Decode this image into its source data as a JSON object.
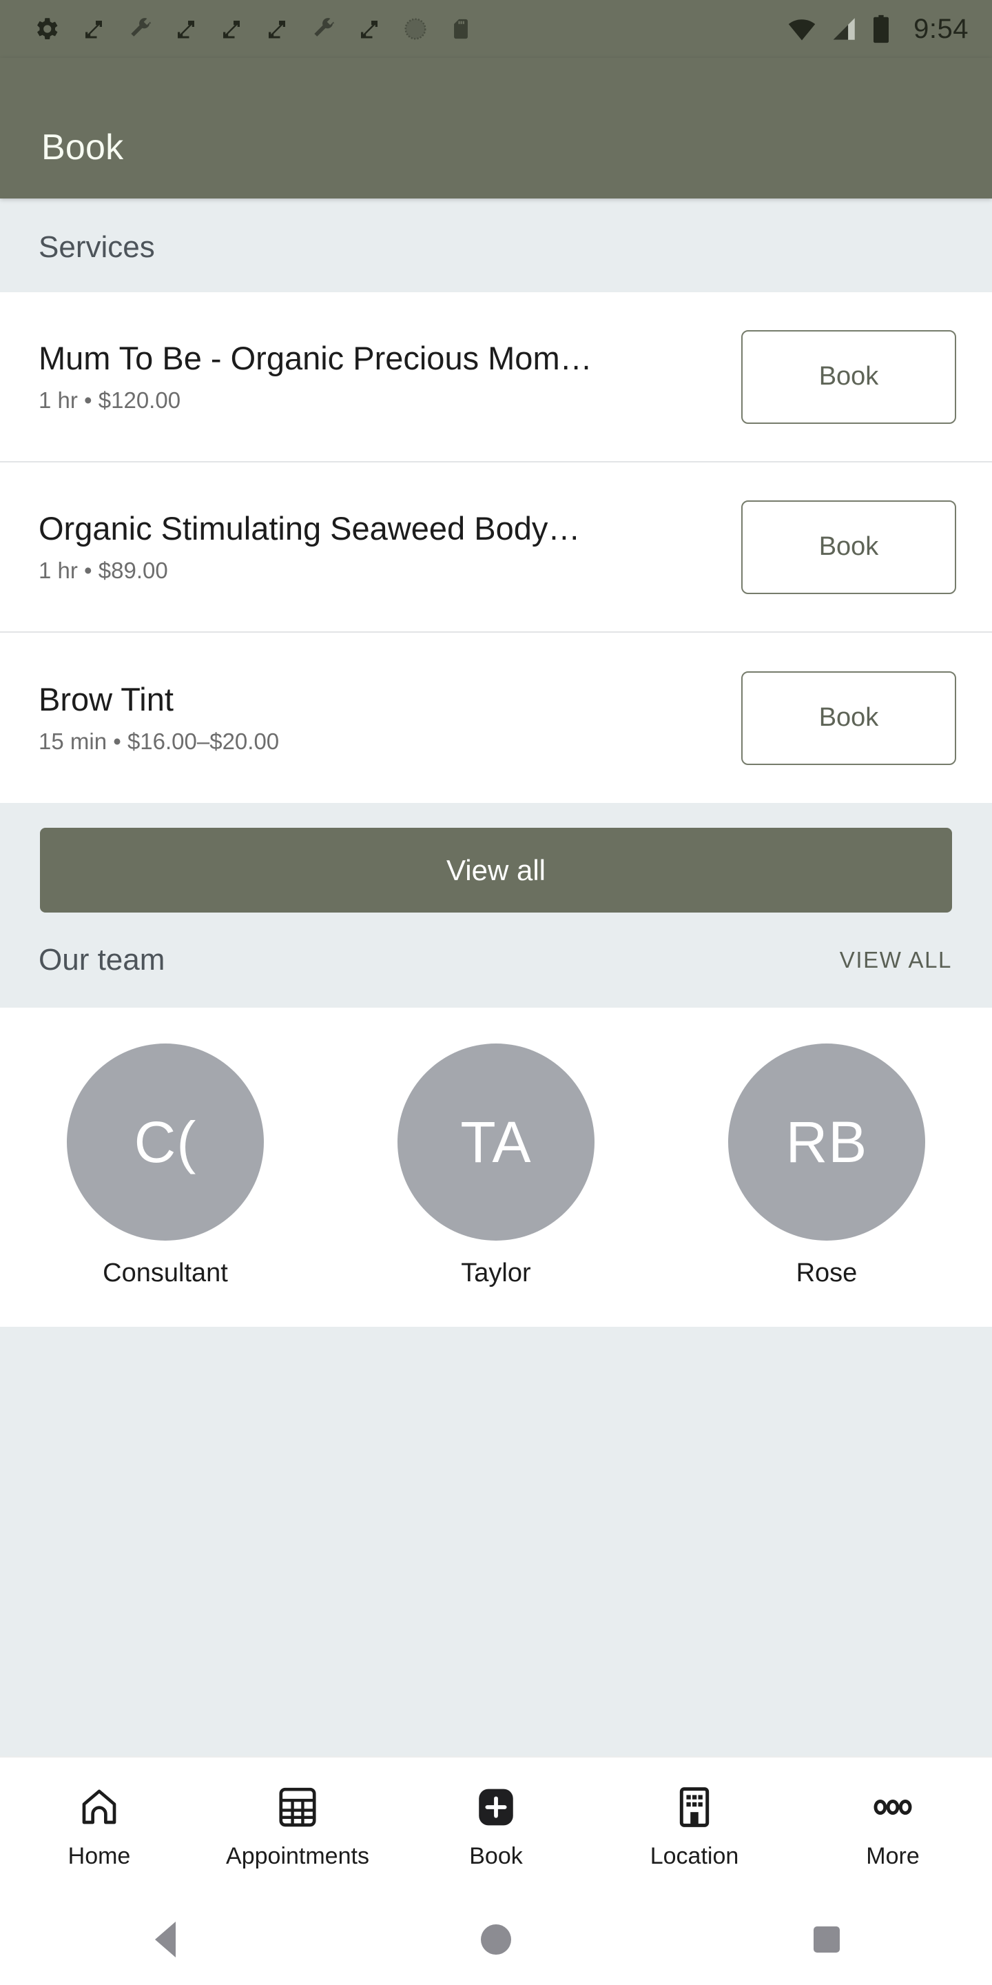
{
  "status_bar": {
    "time": "9:54",
    "left_icons": [
      "gear-icon",
      "fullscreen-icon",
      "wrench-icon",
      "fullscreen-icon",
      "fullscreen-icon",
      "fullscreen-icon",
      "wrench-icon",
      "fullscreen-icon",
      "circle-dotted-icon",
      "sd-card-icon"
    ],
    "right_icons": [
      "wifi-icon",
      "cellular-signal-icon",
      "battery-icon"
    ]
  },
  "app_bar": {
    "title": "Book"
  },
  "services_section": {
    "heading": "Services",
    "items": [
      {
        "name": "Mum To Be - Organic Precious Mom…",
        "meta": "1 hr • $120.00",
        "duration": "1 hr",
        "price": "$120.00",
        "button": "Book"
      },
      {
        "name": "Organic Stimulating Seaweed Body…",
        "meta": "1 hr • $89.00",
        "duration": "1 hr",
        "price": "$89.00",
        "button": "Book"
      },
      {
        "name": "Brow Tint",
        "meta": "15 min • $16.00–$20.00",
        "duration": "15 min",
        "price": "$16.00–$20.00",
        "button": "Book"
      }
    ],
    "view_all_button": "View all"
  },
  "team_section": {
    "heading": "Our team",
    "view_all_link": "VIEW ALL",
    "members": [
      {
        "initials": "C(",
        "name": "Consultant"
      },
      {
        "initials": "TA",
        "name": "Taylor"
      },
      {
        "initials": "RB",
        "name": "Rose"
      }
    ]
  },
  "bottom_nav": {
    "items": [
      {
        "label": "Home",
        "icon": "home-icon"
      },
      {
        "label": "Appointments",
        "icon": "calendar-grid-icon"
      },
      {
        "label": "Book",
        "icon": "plus-square-icon"
      },
      {
        "label": "Location",
        "icon": "building-icon"
      },
      {
        "label": "More",
        "icon": "ellipsis-icon"
      }
    ]
  },
  "system_nav": {
    "back": "back-button",
    "home": "home-button",
    "recents": "recents-button"
  },
  "colors": {
    "brand_green": "#6b7060",
    "section_bg": "#e8edef",
    "avatar_gray": "#a4a7ad",
    "status_bar_text": "#23271d"
  }
}
